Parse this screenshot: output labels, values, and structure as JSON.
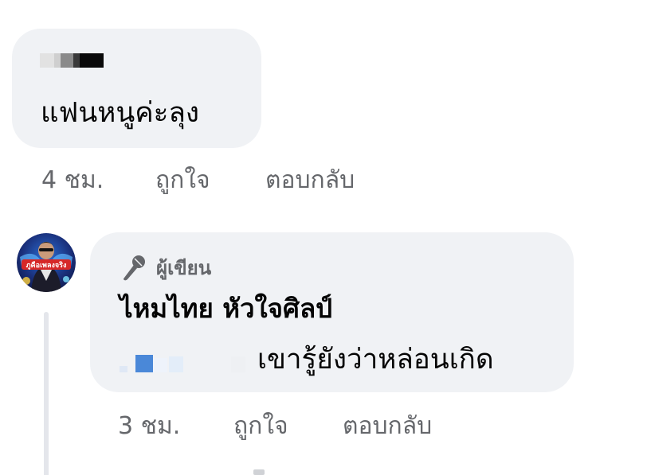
{
  "comment": {
    "text": "แฟนหนูค่ะลุง",
    "time": "4 ชม.",
    "like_label": "ถูกใจ",
    "reply_label": "ตอบกลับ"
  },
  "reply": {
    "badge_label": "ผู้เขียน",
    "badge_icon": "microphone-icon",
    "author_name": "ไหมไทย หัวใจศิลป์",
    "text": "เขารู้ยังว่าหล่อนเกิด",
    "time": "3 ชม.",
    "like_label": "ถูกใจ",
    "reply_label": "ตอบกลับ",
    "avatar_caption": "ภูคือเพลงจริง"
  },
  "colors": {
    "bubble_bg": "#f0f2f5",
    "meta_text": "#65676b",
    "primary_text": "#050505",
    "thread_line": "#e4e6eb"
  }
}
